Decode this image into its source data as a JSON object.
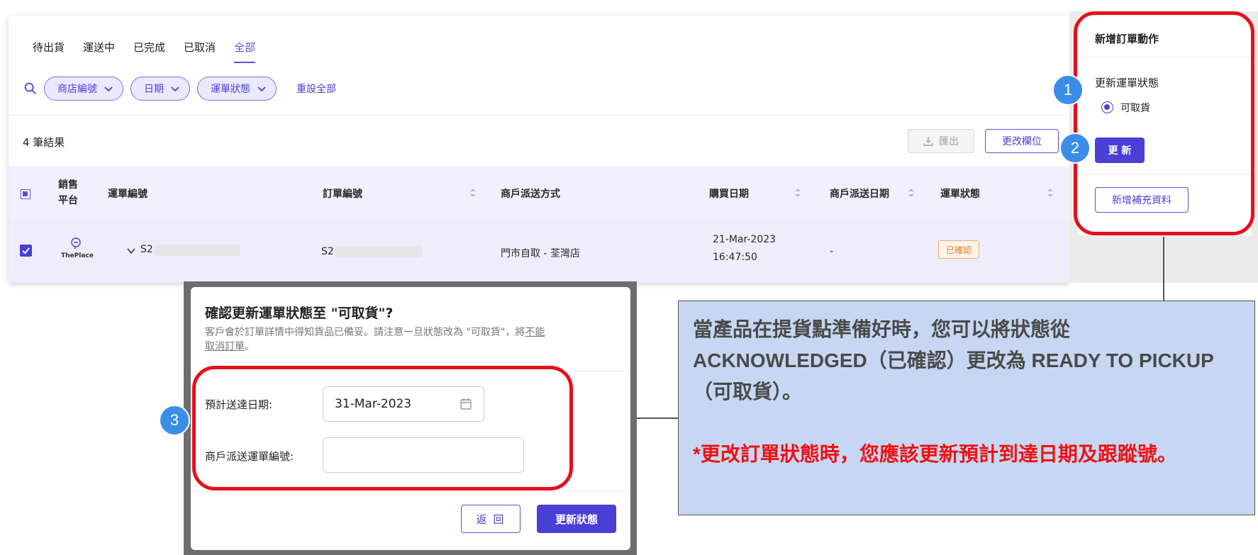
{
  "tabs": [
    {
      "label": "待出貨"
    },
    {
      "label": "運送中"
    },
    {
      "label": "已完成"
    },
    {
      "label": "已取消"
    },
    {
      "label": "全部",
      "active": true
    }
  ],
  "filters": {
    "chips": [
      "商店編號",
      "日期",
      "運單狀態"
    ],
    "reset_label": "重設全部"
  },
  "toolbar": {
    "results": "4 筆結果",
    "export_label": "匯出",
    "columns_label": "更改欄位"
  },
  "table": {
    "headers": [
      "銷售平台",
      "運單編號",
      "訂單編號",
      "商戶派送方式",
      "購買日期",
      "商戶派送日期",
      "運單狀態"
    ],
    "row": {
      "platform": "ThePlace",
      "waybill": "S2",
      "order": "S2",
      "delivery_method": "門市自取 - 荃灣店",
      "purchase_date": "21-Mar-2023",
      "purchase_time": "16:47:50",
      "merchant_date": "-",
      "status": "已確認"
    }
  },
  "actions": {
    "title": "新增訂單動作",
    "subtitle": "更新運單狀態",
    "radio_label": "可取貨",
    "update_label": "更 新",
    "add_info_label": "新增補充資料"
  },
  "steps": [
    "1",
    "2",
    "3"
  ],
  "modal": {
    "title": "確認更新運單狀態至 \"可取貨\"?",
    "desc_pre": "客戶會於訂單詳情中得知貨品已備妥。請注意一旦狀態改為 \"可取貨\"，將",
    "desc_underline": "不能取消訂單",
    "desc_post": "。",
    "eta_label": "預計送達日期:",
    "eta_value": "31-Mar-2023",
    "tracking_label": "商戶派送運單編號:",
    "tracking_value": "",
    "back_label": "返 回",
    "confirm_label": "更新狀態"
  },
  "note": {
    "main": "當產品在提貨點準備好時，您可以將狀態從 ACKNOWLEDGED（已確認）更改為 READY TO PICKUP（可取貨）。",
    "red": "*更改訂單狀態時，您應該更新預計到達日期及跟蹤號。"
  },
  "colors": {
    "accent": "#4a3fd6",
    "highlight": "#e5101c",
    "step": "#3b8de8",
    "note_bg": "#c7d7f3",
    "note_red": "#ee1111"
  }
}
